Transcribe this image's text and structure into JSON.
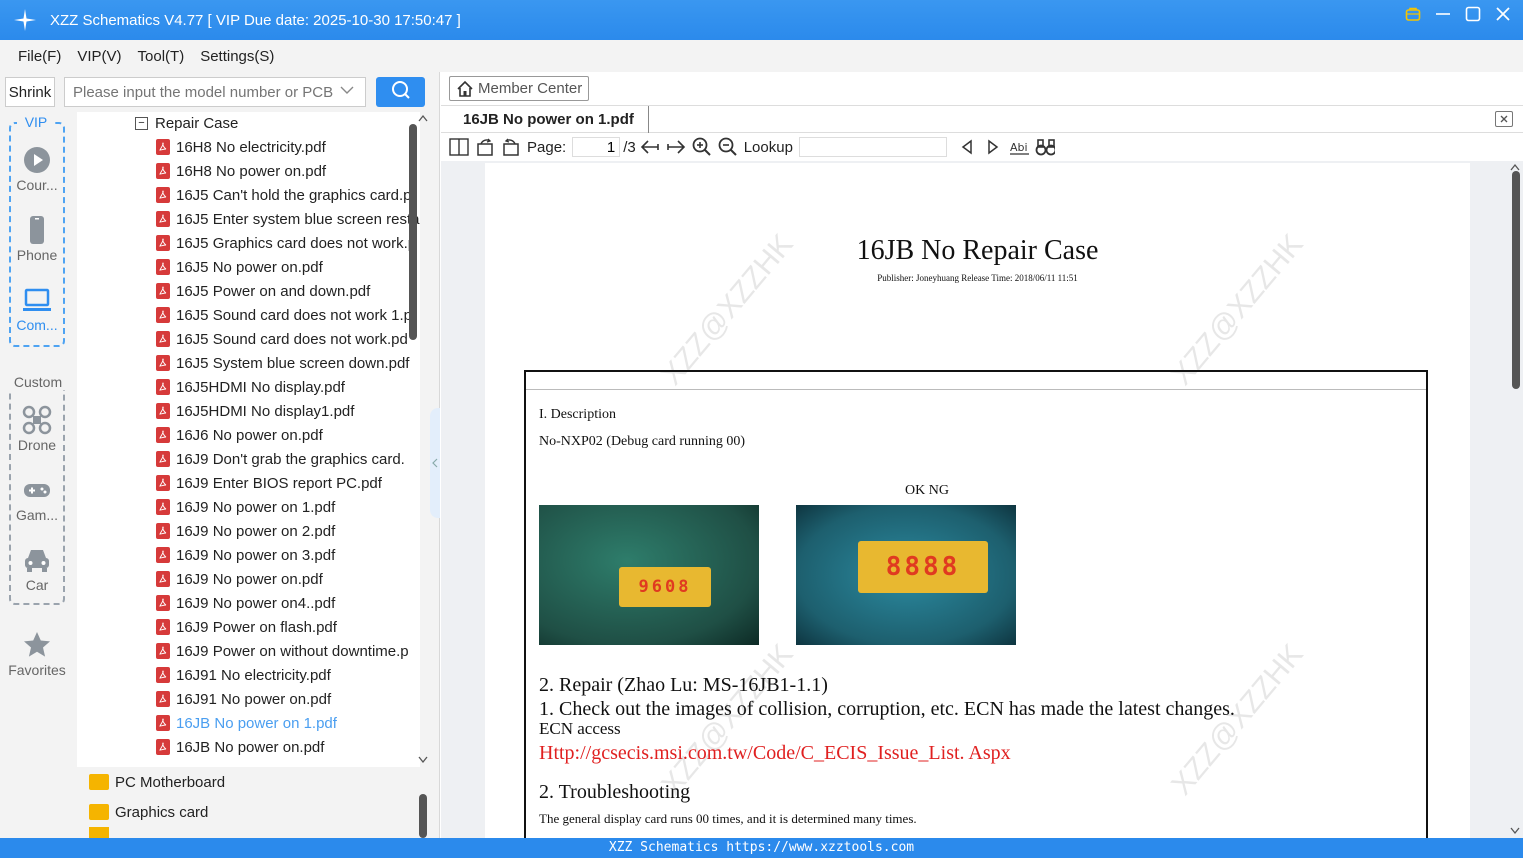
{
  "window": {
    "title": "XZZ Schematics V4.77 [ VIP Due date: 2025-10-30 17:50:47 ]"
  },
  "menu": [
    "File(F)",
    "VIP(V)",
    "Tool(T)",
    "Settings(S)"
  ],
  "search": {
    "shrink_label": "Shrink",
    "placeholder": "Please input the model number or PCB"
  },
  "categories": {
    "vip_label": "VIP",
    "custom_label": "Custom",
    "items": [
      "Cour...",
      "Phone",
      "Com...",
      "Drone",
      "Gam...",
      "Car",
      "Favorites"
    ]
  },
  "tree": {
    "folder": "Repair Case",
    "files": [
      "16H8 No electricity.pdf",
      "16H8 No power on.pdf",
      "16J5 Can't hold the graphics card.p",
      "16J5 Enter system blue screen resta",
      "16J5 Graphics card does not work.p",
      "16J5 No power on.pdf",
      "16J5 Power on and down.pdf",
      "16J5 Sound card does not work 1.p",
      "16J5 Sound card does not work.pd",
      "16J5 System blue screen down.pdf",
      "16J5HDMI No display.pdf",
      "16J5HDMI No display1.pdf",
      "16J6 No power on.pdf",
      "16J9 Don't grab the graphics card.",
      "16J9 Enter BIOS report PC.pdf",
      "16J9 No power on 1.pdf",
      "16J9 No power on 2.pdf",
      "16J9 No power on 3.pdf",
      "16J9 No power on.pdf",
      "16J9 No power on4..pdf",
      "16J9 Power on flash.pdf",
      "16J9 Power on without downtime.p",
      "16J91 No electricity.pdf",
      "16J91 No power on.pdf",
      "16JB No power on 1.pdf",
      "16JB No power on.pdf"
    ],
    "selected_index": 24
  },
  "folders": [
    "PC Motherboard",
    "Graphics card"
  ],
  "viewer": {
    "member_center": "Member Center",
    "tab": "16JB No power on 1.pdf",
    "page_label": "Page:",
    "page_current": "1",
    "page_total": "/3",
    "lookup_label": "Lookup"
  },
  "document": {
    "title": "16JB No Repair Case",
    "publisher": "Publisher: Joneyhuang Release Time: 2018/06/11 11:51",
    "section1": "I. Description",
    "desc": "No-NXP02 (Debug card running 00)",
    "ok_ng": "OK NG",
    "photo1_digits": "9608",
    "photo2_digits": "8888",
    "repair_heading": "2. Repair (Zhao Lu: MS-16JB1-1.1)",
    "repair_step": "1. Check out the images of collision, corruption, etc. ECN has made the latest changes.",
    "ecn_label": "ECN access",
    "ecn_link": "Http://gcsecis.msi.com.tw/Code/C_ECIS_Issue_List. Aspx",
    "trouble_heading": "2. Troubleshooting",
    "trouble_text": "The general display card runs 00 times, and it is determined many times.",
    "watermark": "XZZ@XZZHK",
    "link_color": "#e02020"
  },
  "statusbar": "XZZ Schematics https://www.xzztools.com"
}
